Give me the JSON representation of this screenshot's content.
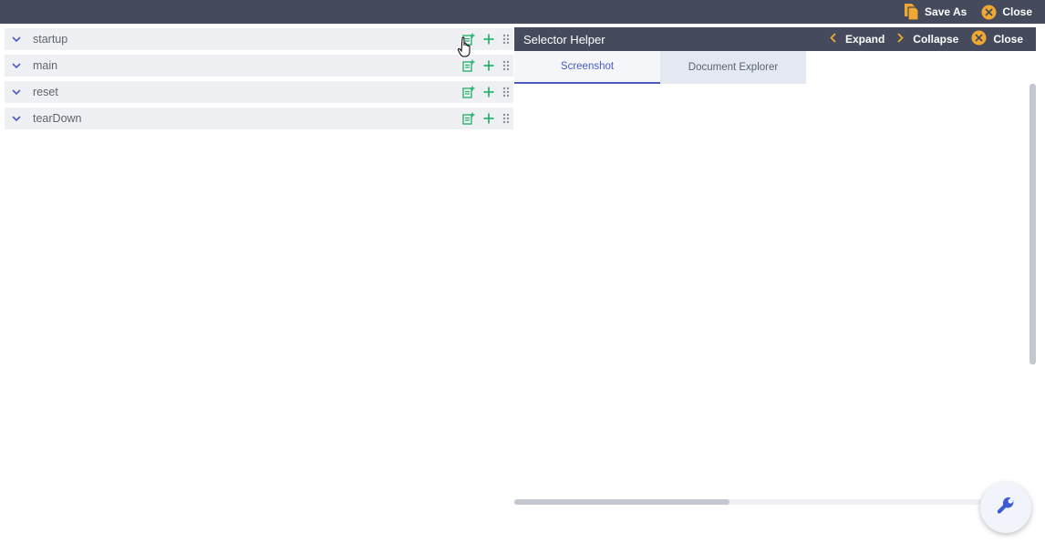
{
  "topbar": {
    "save_as_label": "Save As",
    "close_label": "Close"
  },
  "sections": [
    {
      "label": "startup"
    },
    {
      "label": "main"
    },
    {
      "label": "reset"
    },
    {
      "label": "tearDown"
    }
  ],
  "helper": {
    "title": "Selector Helper",
    "expand_label": "Expand",
    "collapse_label": "Collapse",
    "close_label": "Close",
    "tabs": [
      {
        "label": "Screenshot",
        "active": true
      },
      {
        "label": "Document Explorer",
        "active": false
      }
    ]
  },
  "colors": {
    "header_bg": "#454b5c",
    "accent_orange": "#f0a830",
    "action_green": "#2db36f",
    "tab_active": "#4a5bc4",
    "section_bg": "#eef0f4"
  },
  "icons": {
    "save_as": "copy-icon",
    "close": "close-circle-icon",
    "expand": "chevron-left-icon",
    "collapse": "chevron-right-icon",
    "section_toggle": "chevron-down-icon",
    "add_doc": "add-note-icon",
    "add": "plus-icon",
    "drag": "drag-handle-icon",
    "fab": "wrench-icon"
  }
}
